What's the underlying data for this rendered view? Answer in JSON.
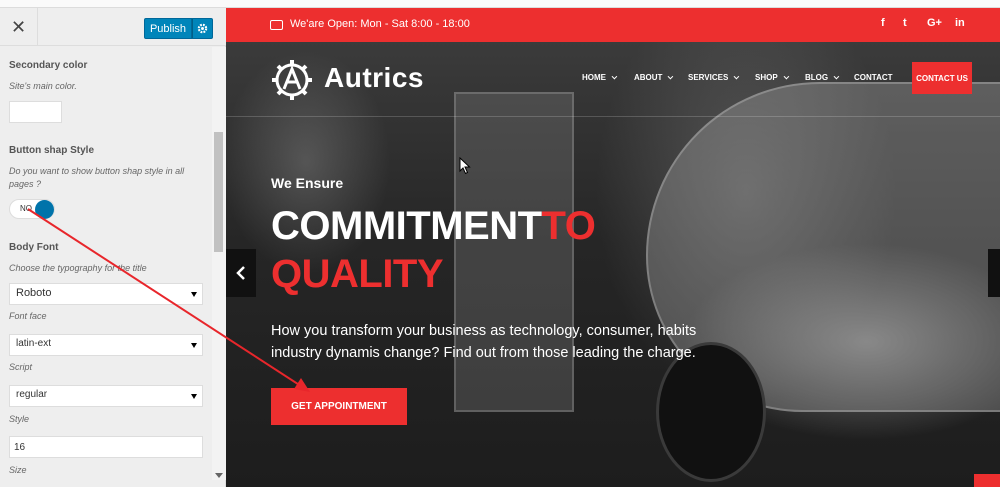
{
  "colors": {
    "accent": "#ed2f2f",
    "publish": "#0085ba",
    "toggle": "#0073aa",
    "annotation": "#e8262b"
  },
  "panel": {
    "publish_label": "Publish",
    "secondary_color": {
      "title": "Secondary color",
      "desc": "Site's main color."
    },
    "button_shape": {
      "title": "Button shap Style",
      "desc": "Do you want to show button shap style in all pages ?",
      "toggle_label": "NO"
    },
    "body_font": {
      "title": "Body Font",
      "desc": "Choose the typography for the title",
      "font_value": "Roboto",
      "font_face_label": "Font face",
      "script_value": "latin-ext",
      "script_label": "Script",
      "style_value": "regular",
      "style_label": "Style",
      "size_value": "16",
      "size_label": "Size"
    }
  },
  "site": {
    "hours": "We'are Open: Mon - Sat 8:00 - 18:00",
    "social": [
      "f",
      "t",
      "G+",
      "in"
    ],
    "logo": "Autrics",
    "nav": [
      {
        "label": "HOME",
        "dropdown": true
      },
      {
        "label": "ABOUT",
        "dropdown": true
      },
      {
        "label": "SERVICES",
        "dropdown": true
      },
      {
        "label": "SHOP",
        "dropdown": true
      },
      {
        "label": "BLOG",
        "dropdown": true
      },
      {
        "label": "CONTACT",
        "dropdown": false
      }
    ],
    "contact_button": "CONTACT US",
    "hero": {
      "kicker": "We Ensure",
      "headline_white": "COMMITMENT",
      "headline_red_1": "TO",
      "headline_red_2": "QUALITY",
      "lead": "How you transform your business as technology, consumer, habits industry dynamis change? Find out from those leading the charge.",
      "cta": "GET APPOINTMENT"
    }
  }
}
